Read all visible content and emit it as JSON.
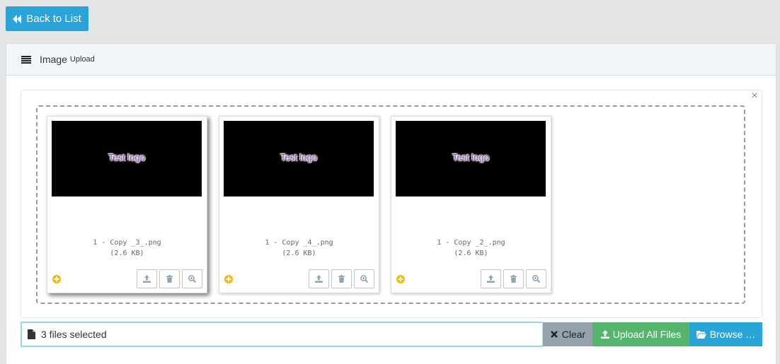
{
  "back_button": {
    "label": "Back to List",
    "icon": "backward-icon"
  },
  "panel": {
    "title": "Image",
    "subtitle": "Upload",
    "icon": "bars-icon"
  },
  "files": [
    {
      "logo_text": "Test logo",
      "name": "1 - Copy _3_.png",
      "size": "(2.6 KB)",
      "active": true
    },
    {
      "logo_text": "Test logo",
      "name": "1 - Copy _4_.png",
      "size": "(2.6 KB)",
      "active": false
    },
    {
      "logo_text": "Test logo",
      "name": "1 - Copy _2_.png",
      "size": "(2.6 KB)",
      "active": false
    }
  ],
  "thumb_actions": [
    "upload-icon",
    "trash-icon",
    "zoom-in-icon"
  ],
  "close_label": "×",
  "caption": {
    "text": "3 files selected",
    "icon": "file-icon"
  },
  "buttons": {
    "clear": "Clear",
    "upload_all": "Upload All Files",
    "browse": "Browse …"
  },
  "colors": {
    "primary": "#2aa3d6",
    "success": "#55b56d",
    "secondary": "#94a2ad",
    "status_pending": "#f5b80d"
  }
}
